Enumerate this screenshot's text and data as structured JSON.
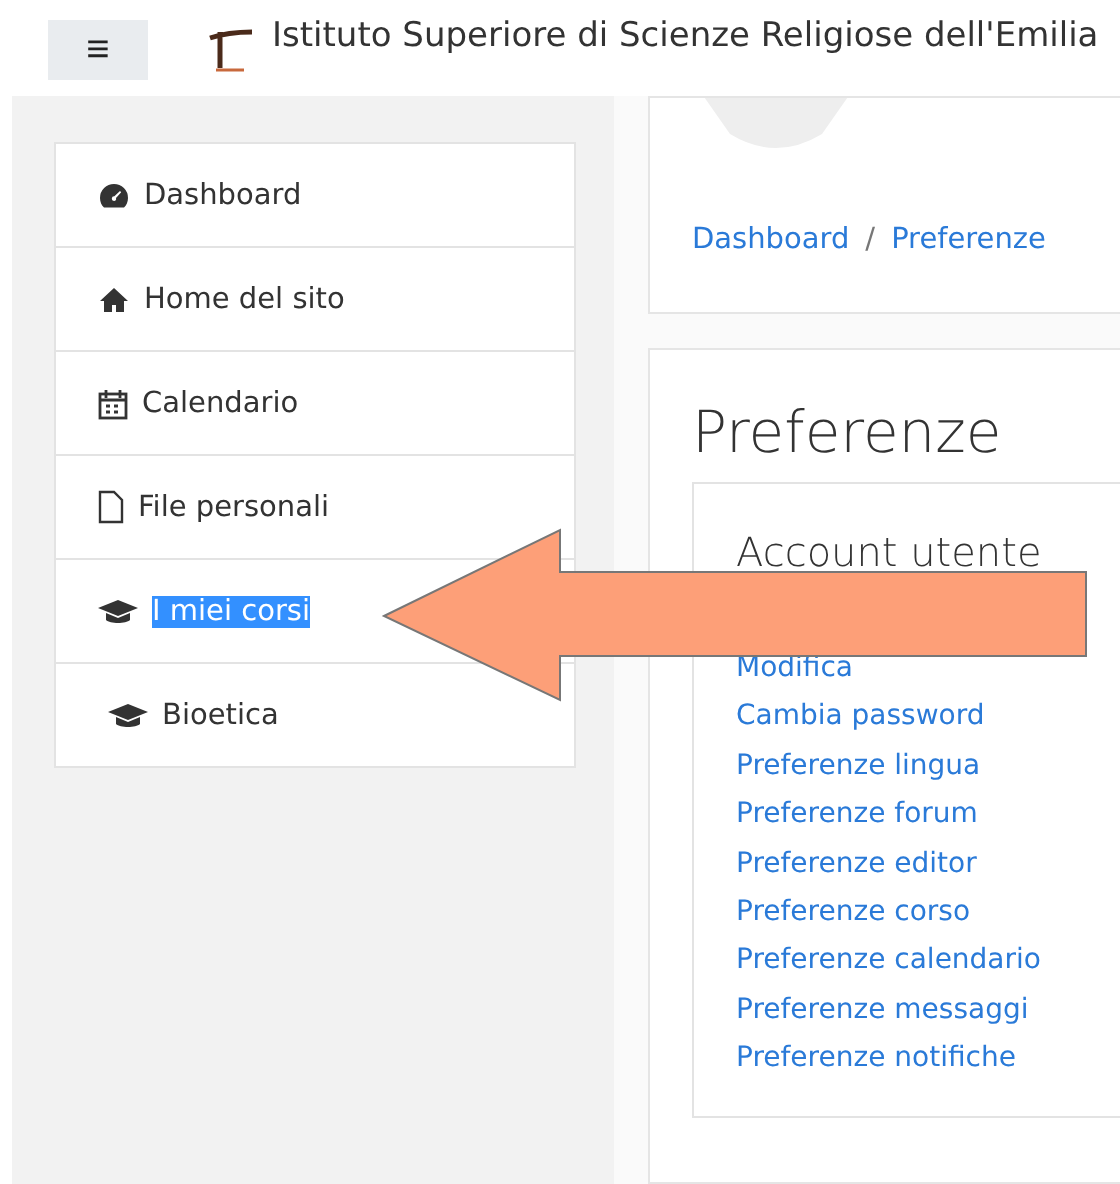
{
  "header": {
    "menu_button": "≡",
    "site_title": "Istituto Superiore di Scienze Religiose dell'Emilia"
  },
  "sidebar": {
    "items": [
      {
        "label": "Dashboard",
        "highlighted": false
      },
      {
        "label": "Home del sito",
        "highlighted": false
      },
      {
        "label": "Calendario",
        "highlighted": false
      },
      {
        "label": "File personali",
        "highlighted": false
      },
      {
        "label": "I miei corsi",
        "highlighted": true
      },
      {
        "label": "Bioetica",
        "highlighted": false
      }
    ]
  },
  "breadcrumb": [
    "Dashboard",
    "Preferenze"
  ],
  "breadcrumb_separator": "/",
  "page_title": "Preferenze",
  "section": {
    "title": "Account utente",
    "links": [
      "Modifica",
      "Cambia password",
      "Preferenze lingua",
      "Preferenze forum",
      "Preferenze editor",
      "Preferenze corso",
      "Preferenze calendario",
      "Preferenze messaggi",
      "Preferenze notifiche"
    ]
  }
}
